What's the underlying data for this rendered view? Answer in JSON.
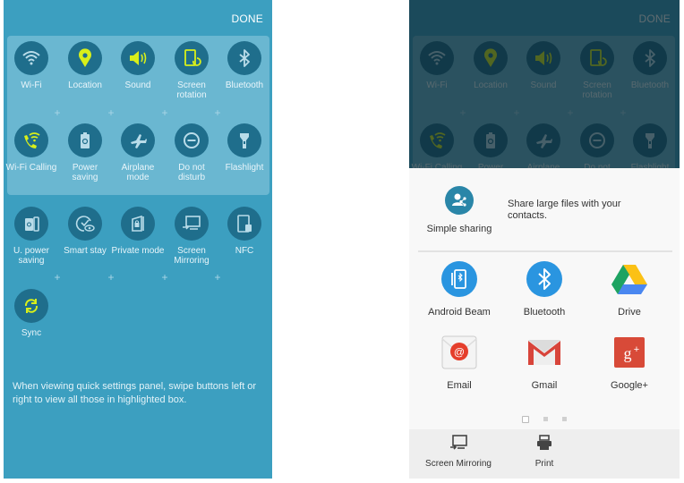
{
  "left_panel": {
    "done_label": "DONE",
    "highlighted_tiles": [
      {
        "label": "Wi-Fi",
        "icon": "wifi-icon",
        "active": false
      },
      {
        "label": "Location",
        "icon": "location-pin-icon",
        "active": true
      },
      {
        "label": "Sound",
        "icon": "speaker-icon",
        "active": true
      },
      {
        "label": "Screen rotation",
        "icon": "screen-rotation-icon",
        "active": true
      },
      {
        "label": "Bluetooth",
        "icon": "bluetooth-icon",
        "active": false
      },
      {
        "label": "Wi-Fi Calling",
        "icon": "wifi-calling-icon",
        "active": true
      },
      {
        "label": "Power saving",
        "icon": "battery-recycle-icon",
        "active": false
      },
      {
        "label": "Airplane mode",
        "icon": "airplane-icon",
        "active": false
      },
      {
        "label": "Do not disturb",
        "icon": "do-not-disturb-icon",
        "active": false
      },
      {
        "label": "Flashlight",
        "icon": "flashlight-icon",
        "active": false
      }
    ],
    "other_tiles": [
      {
        "label": "U. power saving",
        "icon": "ultra-power-saving-icon",
        "active": false
      },
      {
        "label": "Smart stay",
        "icon": "smart-stay-icon",
        "active": false
      },
      {
        "label": "Private mode",
        "icon": "private-mode-icon",
        "active": false
      },
      {
        "label": "Screen Mirroring",
        "icon": "screen-mirroring-icon",
        "active": false
      },
      {
        "label": "NFC",
        "icon": "nfc-icon",
        "active": false
      },
      {
        "label": "Sync",
        "icon": "sync-icon",
        "active": true
      }
    ],
    "hint": "When viewing quick settings panel, swipe buttons left or right to view all those in highlighted box."
  },
  "right_panel": {
    "done_label": "DONE",
    "simple_sharing": {
      "label": "Simple sharing",
      "description": "Share large files with your contacts."
    },
    "share_apps": [
      {
        "label": "Android Beam",
        "icon": "android-beam-icon"
      },
      {
        "label": "Bluetooth",
        "icon": "bluetooth-icon"
      },
      {
        "label": "Drive",
        "icon": "google-drive-icon"
      },
      {
        "label": "Email",
        "icon": "email-icon"
      },
      {
        "label": "Gmail",
        "icon": "gmail-icon"
      },
      {
        "label": "Google+",
        "icon": "google-plus-icon"
      }
    ],
    "page_indicator": {
      "current": 1,
      "total": 3
    },
    "bottom_actions": [
      {
        "label": "Screen Mirroring",
        "icon": "screen-mirroring-icon"
      },
      {
        "label": "Print",
        "icon": "printer-icon"
      }
    ]
  },
  "colors": {
    "panel_bg": "#3c9fc0",
    "highlight_bg": "#6ab7d1",
    "tile_circle": "#1f6e8c",
    "active_icon": "#d8ef1a",
    "inactive_icon": "#b9dce9"
  }
}
